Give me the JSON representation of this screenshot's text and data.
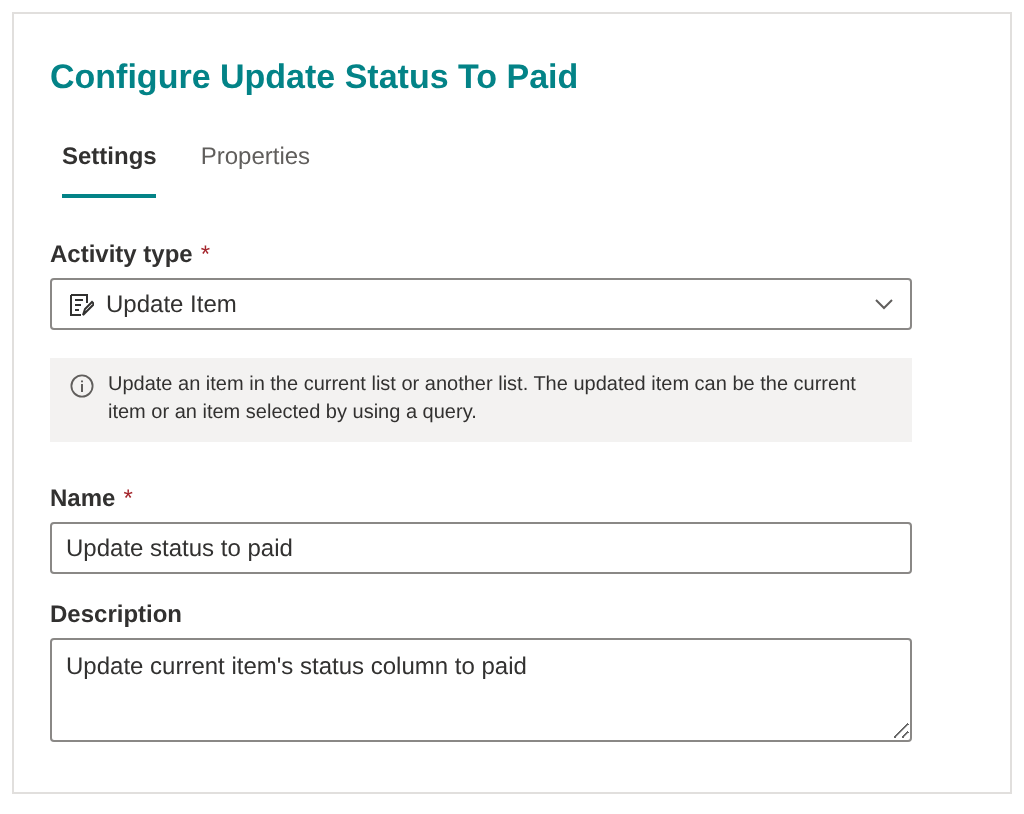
{
  "title": "Configure Update Status To Paid",
  "tabs": [
    {
      "label": "Settings",
      "selected": true
    },
    {
      "label": "Properties",
      "selected": false
    }
  ],
  "activity_type": {
    "label": "Activity type",
    "required_mark": "*",
    "value": "Update Item"
  },
  "info": "Update an item in the current list or another list. The updated item can be the current item or an item selected by using a query.",
  "name": {
    "label": "Name",
    "required_mark": "*",
    "value": "Update status to paid"
  },
  "description": {
    "label": "Description",
    "value": "Update current item's status column to paid"
  }
}
